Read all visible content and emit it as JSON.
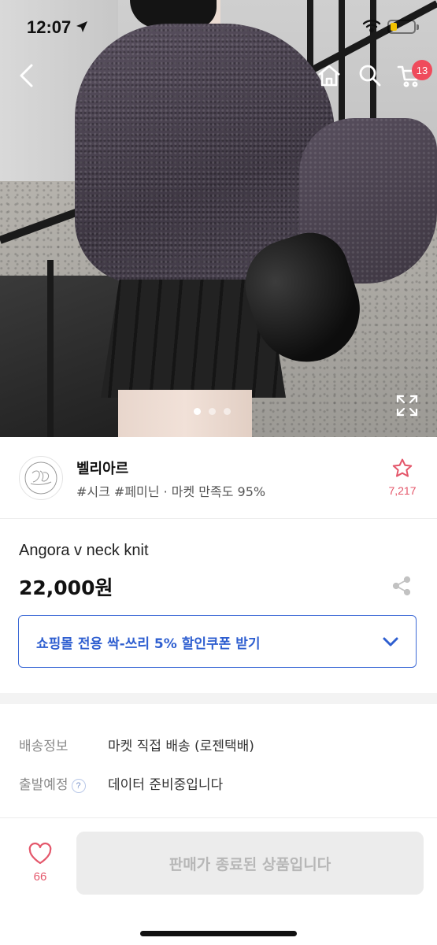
{
  "status_bar": {
    "time": "12:07"
  },
  "nav": {
    "cart_count": "13"
  },
  "gallery": {
    "pages": 3,
    "active_index": 0
  },
  "shop": {
    "name": "벨리아르",
    "tags": "#시크 #페미닌 · 마켓 만족도 95%",
    "favorite_count": "7,217"
  },
  "product": {
    "title": "Angora v neck knit",
    "price": "22,000원"
  },
  "coupon": {
    "label": "쇼핑몰 전용 싹-쓰리 5% 할인쿠폰 받기"
  },
  "shipping": {
    "rows": [
      {
        "key": "배송정보",
        "value": "마켓 직접 배송 (로젠택배)"
      },
      {
        "key": "출발예정",
        "value": "데이터 준비중입니다",
        "help": "?"
      }
    ]
  },
  "bottom_bar": {
    "like_count": "66",
    "buy_label": "판매가 종료된 상품입니다"
  },
  "colors": {
    "accent_blue": "#2f5fd0",
    "accent_pink": "#e4566a",
    "badge_red": "#ef4b5c",
    "disabled_button": "#ececec"
  },
  "icons": [
    "back-icon",
    "home-icon",
    "search-icon",
    "cart-icon",
    "expand-icon",
    "star-icon",
    "share-icon",
    "chevron-down-icon",
    "heart-icon",
    "help-icon"
  ]
}
